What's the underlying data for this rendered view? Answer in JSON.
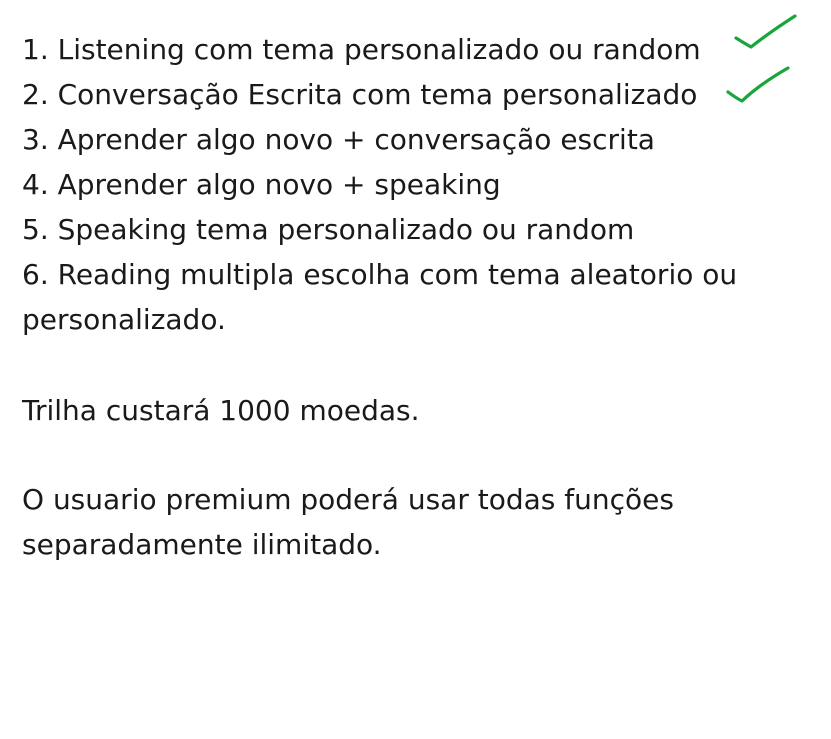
{
  "list": {
    "items": [
      {
        "label": "1. Listening com tema personalizado ou random",
        "checked": true
      },
      {
        "label": "2. Conversação Escrita com tema personalizado",
        "checked": true
      },
      {
        "label": "3. Aprender algo novo + conversação escrita",
        "checked": false
      },
      {
        "label": "4. Aprender algo novo + speaking",
        "checked": false
      },
      {
        "label": "5. Speaking tema personalizado ou random",
        "checked": false
      },
      {
        "label": "6. Reading multipla escolha com tema aleatorio ou personalizado.",
        "checked": false
      }
    ]
  },
  "paragraphs": {
    "cost": "Trilha custará 1000 moedas.",
    "premium": "O usuario premium poderá usar todas funções separadamente ilimitado."
  },
  "icons": {
    "check": "checkmark-icon",
    "check_color": "#1aa53a"
  }
}
